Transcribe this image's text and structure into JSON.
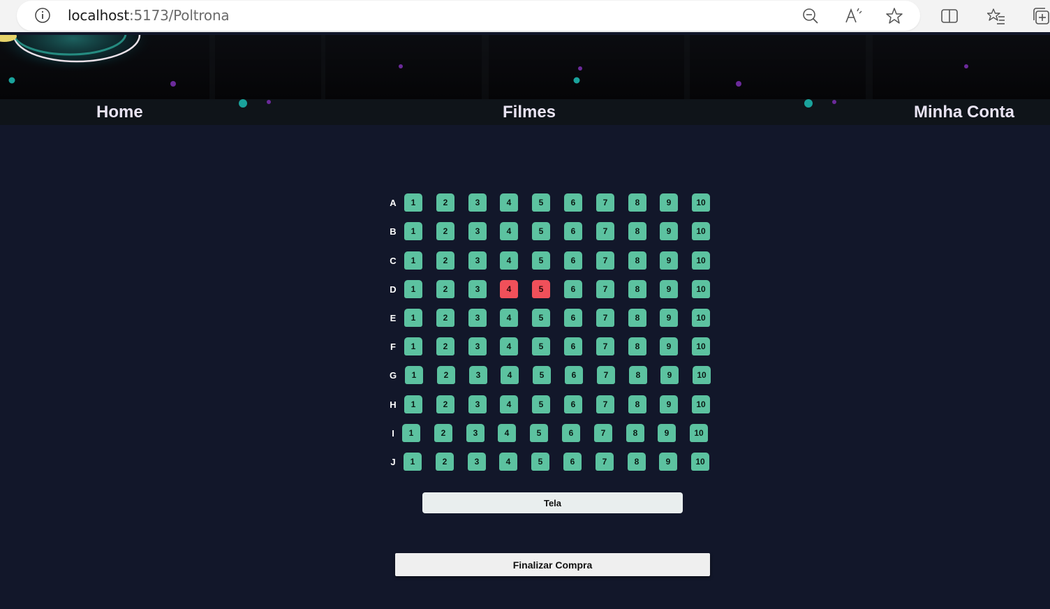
{
  "browser": {
    "url_host": "localhost",
    "url_path": ":5173/Poltrona"
  },
  "nav": {
    "home": "Home",
    "movies": "Filmes",
    "account": "Minha Conta"
  },
  "seating": {
    "rows": [
      "A",
      "B",
      "C",
      "D",
      "E",
      "F",
      "G",
      "H",
      "I",
      "J"
    ],
    "seat_numbers": [
      "1",
      "2",
      "3",
      "4",
      "5",
      "6",
      "7",
      "8",
      "9",
      "10"
    ],
    "taken": [
      {
        "row": "D",
        "seat": "4"
      },
      {
        "row": "D",
        "seat": "5"
      }
    ],
    "available_color": "#5cc2a0",
    "taken_color": "#f0505a"
  },
  "screen_label": "Tela",
  "finish_button": "Finalizar Compra",
  "colors": {
    "page_bg": "#12172a",
    "nav_bg": "#0f1419",
    "nav_text": "#e8e3f2"
  }
}
